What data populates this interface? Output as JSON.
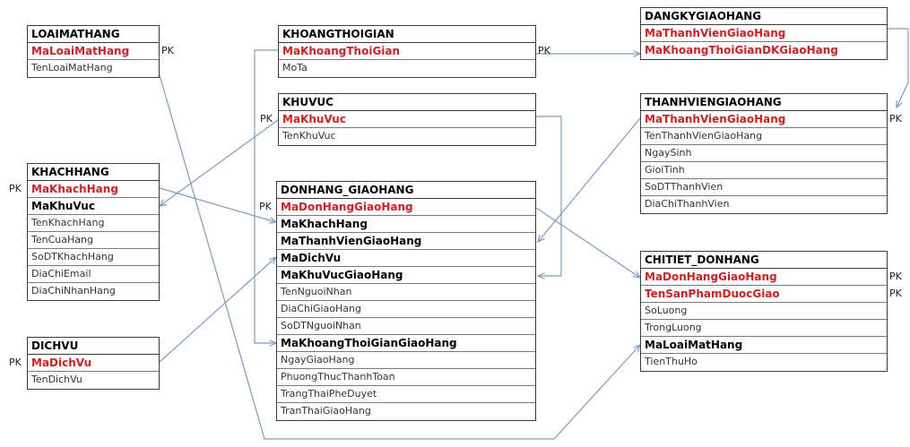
{
  "colors": {
    "primary_key": "#e01a1a",
    "link": "#7a9cc6",
    "border": "#3a3a3a"
  },
  "pk_label": "PK",
  "entities": [
    {
      "id": "loaimathang",
      "title": "LOAIMATHANG",
      "fields": [
        {
          "name": "MaLoaiMatHang",
          "kind": "pk"
        },
        {
          "name": "TenLoaiMatHang",
          "kind": "plain"
        }
      ]
    },
    {
      "id": "khoangthoigian",
      "title": "KHOANGTHOIGIAN",
      "fields": [
        {
          "name": "MaKhoangThoiGian",
          "kind": "pk"
        },
        {
          "name": "MoTa",
          "kind": "plain"
        }
      ]
    },
    {
      "id": "dangkygiaohang",
      "title": "DANGKYGIAOHANG",
      "fields": [
        {
          "name": "MaThanhVienGiaoHang",
          "kind": "pk"
        },
        {
          "name": "MaKhoangThoiGianDKGiaoHang",
          "kind": "pk"
        }
      ]
    },
    {
      "id": "khuvuc",
      "title": "KHUVUC",
      "fields": [
        {
          "name": "MaKhuVuc",
          "kind": "pk"
        },
        {
          "name": "TenKhuVuc",
          "kind": "plain"
        }
      ]
    },
    {
      "id": "thanhviengiaohang",
      "title": "THANHVIENGIAOHANG",
      "fields": [
        {
          "name": "MaThanhVienGiaoHang",
          "kind": "pk"
        },
        {
          "name": "TenThanhVienGiaoHang",
          "kind": "plain"
        },
        {
          "name": "NgaySinh",
          "kind": "plain"
        },
        {
          "name": "GioiTinh",
          "kind": "plain"
        },
        {
          "name": "SoDTThanhVien",
          "kind": "plain"
        },
        {
          "name": "DiaChiThanhVien",
          "kind": "plain"
        }
      ]
    },
    {
      "id": "khachhang",
      "title": "KHACHHANG",
      "fields": [
        {
          "name": "MaKhachHang",
          "kind": "pk"
        },
        {
          "name": "MaKhuVuc",
          "kind": "fk"
        },
        {
          "name": "TenKhachHang",
          "kind": "plain"
        },
        {
          "name": "TenCuaHang",
          "kind": "plain"
        },
        {
          "name": "SoDTKhachHang",
          "kind": "plain"
        },
        {
          "name": "DiaChiEmail",
          "kind": "plain"
        },
        {
          "name": "DiaChiNhanHang",
          "kind": "plain"
        }
      ]
    },
    {
      "id": "donhang_giaohang",
      "title": "DONHANG_GIAOHANG",
      "fields": [
        {
          "name": "MaDonHangGiaoHang",
          "kind": "pk"
        },
        {
          "name": "MaKhachHang",
          "kind": "fk"
        },
        {
          "name": "MaThanhVienGiaoHang",
          "kind": "fk"
        },
        {
          "name": "MaDichVu",
          "kind": "fk"
        },
        {
          "name": "MaKhuVucGiaoHang",
          "kind": "fk"
        },
        {
          "name": "TenNguoiNhan",
          "kind": "plain"
        },
        {
          "name": "DiaChiGiaoHang",
          "kind": "plain"
        },
        {
          "name": "SoDTNguoiNhan",
          "kind": "plain"
        },
        {
          "name": "MaKhoangThoiGianGiaoHang",
          "kind": "fk"
        },
        {
          "name": "NgayGiaoHang",
          "kind": "plain"
        },
        {
          "name": "PhuongThucThanhToan",
          "kind": "plain"
        },
        {
          "name": "TrangThaiPheDuyet",
          "kind": "plain"
        },
        {
          "name": "TranThaiGiaoHang",
          "kind": "plain"
        }
      ]
    },
    {
      "id": "chitiet_donhang",
      "title": "CHITIET_DONHANG",
      "fields": [
        {
          "name": "MaDonHangGiaoHang",
          "kind": "pk"
        },
        {
          "name": "TenSanPhamDuocGiao",
          "kind": "pk"
        },
        {
          "name": "SoLuong",
          "kind": "plain"
        },
        {
          "name": "TrongLuong",
          "kind": "plain"
        },
        {
          "name": "MaLoaiMatHang",
          "kind": "fk"
        },
        {
          "name": "TienThuHo",
          "kind": "plain"
        }
      ]
    },
    {
      "id": "dichvu",
      "title": "DICHVU",
      "fields": [
        {
          "name": "MaDichVu",
          "kind": "pk"
        },
        {
          "name": "TenDichVu",
          "kind": "plain"
        }
      ]
    }
  ]
}
